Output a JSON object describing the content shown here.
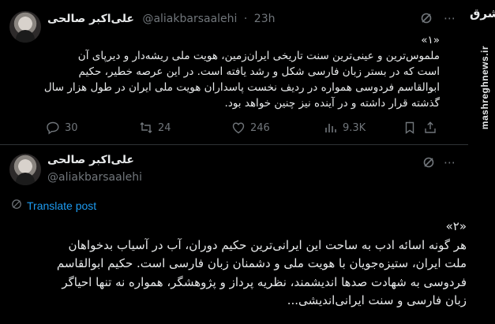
{
  "tweet1": {
    "name": "علی‌اکبر صالحی",
    "handle": "@aliakbarsaalehi",
    "dot": "·",
    "time": "23h",
    "more": "⋯",
    "lines": [
      "«۱»",
      "ملموس‌ترین و عینی‌ترین سنت تاریخی ایران‌زمین، هویت ملی ریشه‌دار و دیرپای آن",
      "است که در بستر زبان فارسی شکل و رشد یافته است. در این عرصه خطیر، حکیم",
      "ابوالقاسم فردوسی همواره در ردیف نخست پاسداران هویت ملی ایران در طول هزار سال",
      "گذشته قرار داشته و در آینده نیز چنین خواهد بود."
    ],
    "actions": {
      "replies": "30",
      "reposts": "24",
      "likes": "246",
      "views": "9.3K"
    }
  },
  "tweet2": {
    "name": "علی‌اکبر صالحی",
    "handle": "@aliakbarsaalehi",
    "more": "⋯",
    "translate": "Translate post",
    "lines": [
      "«۲»",
      "هر گونه اسائه ادب به ساحت این ایرانی‌ترین حکیم دوران، آب در آسیاب بدخواهان",
      "ملت ایران، ستیزه‌جویان با هویت ملی و دشمنان زبان فارسی است. حکیم ابوالقاسم",
      "فردوسی به شهادت صدها اندیشمند، نظریه پرداز و پژوهشگر، همواره نه تنها احیاگر",
      "زبان فارسی و سنت ایرانی‌اندیشی..."
    ]
  },
  "watermark": {
    "logo": "مشرق",
    "site": "mashreghnews.ir"
  },
  "colors": {
    "background": "#000000",
    "text": "#e7e9ea",
    "muted": "#71767b",
    "link": "#1d9bf0",
    "divider": "#2f3336"
  }
}
